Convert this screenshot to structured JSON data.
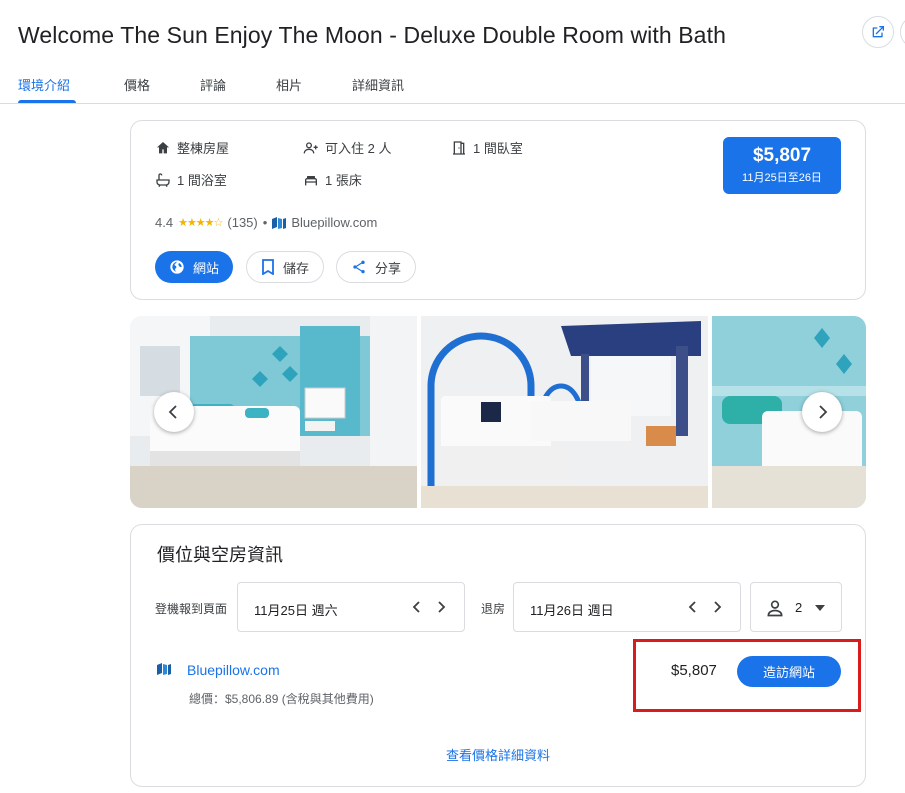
{
  "header": {
    "title": "Welcome The Sun Enjoy The Moon - Deluxe Double Room with Bath"
  },
  "tabs": [
    {
      "label": "環境介紹",
      "active": true
    },
    {
      "label": "價格"
    },
    {
      "label": "評論"
    },
    {
      "label": "相片"
    },
    {
      "label": "詳細資訊"
    }
  ],
  "overview": {
    "features": [
      {
        "icon": "home-icon",
        "label": "整棟房屋"
      },
      {
        "icon": "guests-icon",
        "label": "可入住 2 人"
      },
      {
        "icon": "door-icon",
        "label": "1 間臥室"
      },
      {
        "icon": "bathtub-icon",
        "label": "1 間浴室"
      },
      {
        "icon": "bed-icon",
        "label": "1 張床"
      }
    ],
    "price": "$5,807",
    "dates": "11月25日至26日",
    "rating": "4.4",
    "stars": "★★★★☆",
    "reviews": "(135)",
    "separator": "•",
    "provider": "Bluepillow.com",
    "buttons": {
      "website": "網站",
      "save": "儲存",
      "share": "分享"
    }
  },
  "booking": {
    "section_title": "價位與空房資訊",
    "checkin_label": "登機報到頁面",
    "checkin_date": "11月25日 週六",
    "checkout_label": "退房",
    "checkout_date": "11月26日 週日",
    "guests": "2",
    "offer": {
      "provider": "Bluepillow.com",
      "total": "總價：$5,806.89 (含稅與其他費用)",
      "price": "$5,807",
      "visit_label": "造訪網站"
    },
    "more_link": "查看價格詳細資料"
  },
  "colors": {
    "accent": "#1a73e8",
    "highlight": "#d81b1b"
  }
}
